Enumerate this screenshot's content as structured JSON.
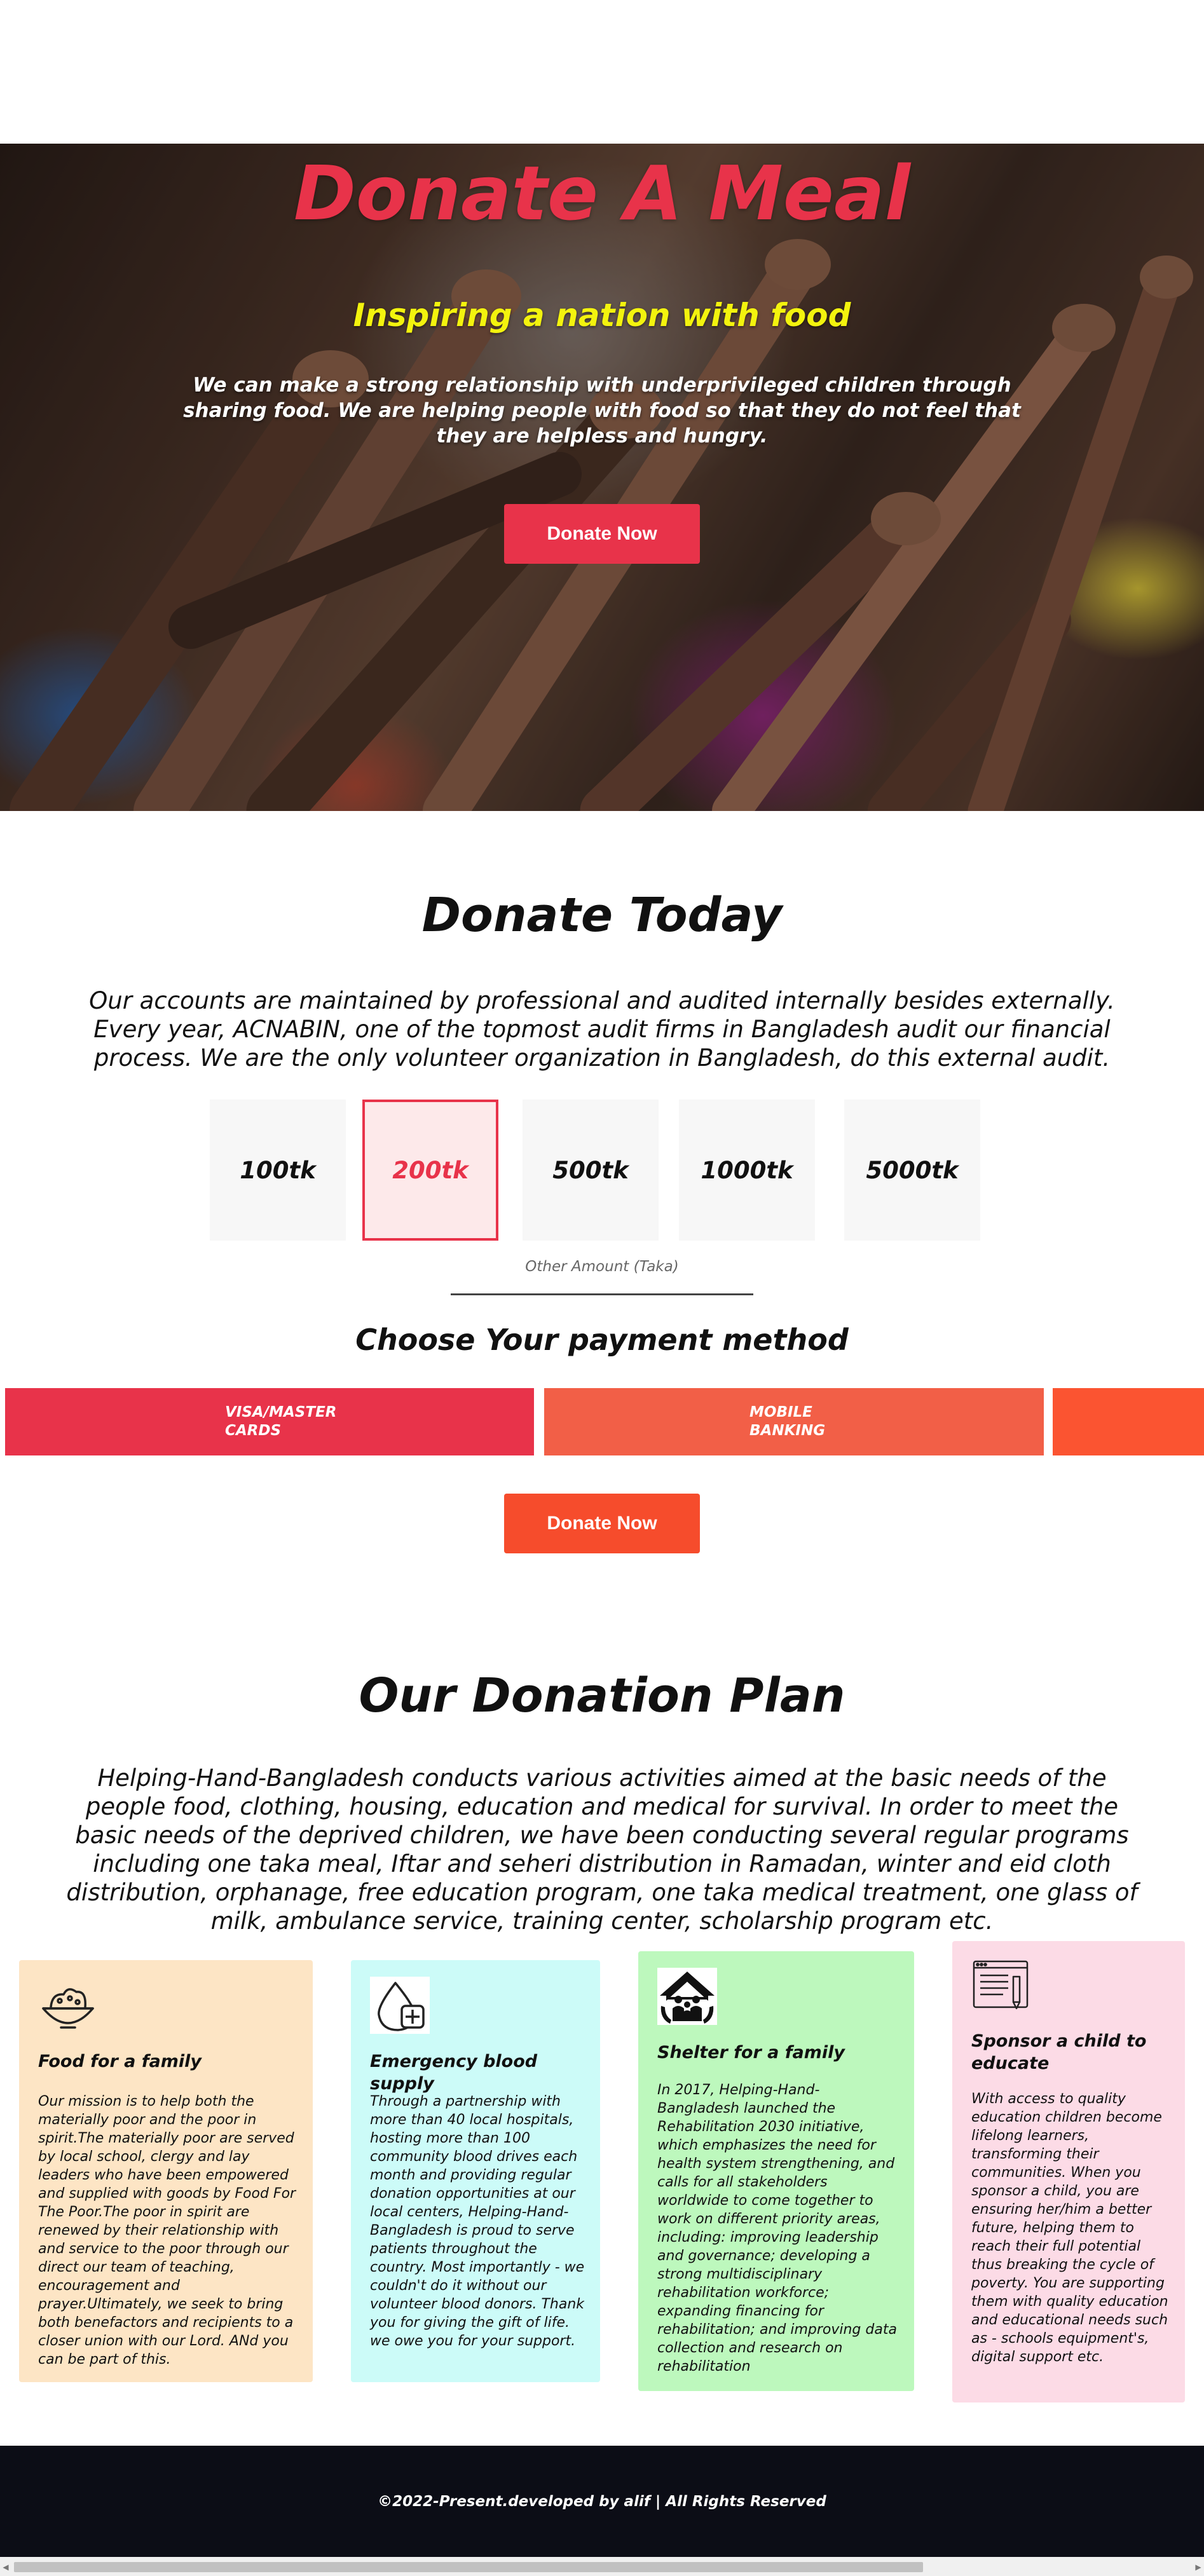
{
  "hero": {
    "title": "Donate A Meal",
    "subtitle": "Inspiring a nation with food",
    "description": "We can make a strong relationship with underprivileged children through sharing food. We are helping people with food so that they do not feel that they are helpless and hungry.",
    "button_label": "Donate Now"
  },
  "donate_today": {
    "title": "Donate Today",
    "text": "Our accounts are maintained by professional and audited internally besides externally. Every year, ACNABIN, one of the topmost audit firms in Bangladesh audit our financial process. We are the only volunteer organization in Bangladesh, do this external audit.",
    "amounts": [
      "100tk",
      "200tk",
      "500tk",
      "1000tk",
      "5000tk"
    ],
    "selected_amount": "200tk",
    "other_amount_placeholder": "Other Amount (Taka)",
    "payment_title": "Choose Your payment method",
    "payment_methods": [
      "VISA/MASTER CARDS",
      "MOBILE BANKING"
    ],
    "button_label": "Donate Now"
  },
  "plan": {
    "title": "Our Donation Plan",
    "text": "Helping-Hand-Bangladesh conducts various activities aimed at the basic needs of the people food, clothing, housing, education and medical for survival. In order to meet the basic needs of the deprived children, we have been conducting several regular programs including one taka meal, Iftar and seheri distribution in Ramadan, winter and eid cloth distribution, orphanage, free education program, one taka medical treatment, one glass of milk, ambulance service, training center, scholarship program etc.",
    "cards": [
      {
        "icon": "food-bowl-icon",
        "title": "Food for a family",
        "text": "Our mission is to help both the materially poor and the poor in spirit.The materially poor are served by local school, clergy and lay leaders who have been empowered and supplied with goods by Food For The Poor.The poor in spirit are renewed by their relationship with and service to the poor through our direct our team of teaching, encouragement and prayer.Ultimately, we seek to bring both benefactors and recipients to a closer union with our Lord. ANd you can be part of this."
      },
      {
        "icon": "blood-drop-icon",
        "title": "Emergency blood supply",
        "text": "Through a partnership with more than 40 local hospitals, hosting more than 100 community blood drives each month and providing regular donation opportunities at our local centers, Helping-Hand-Bangladesh is proud to serve patients throughout the country. Most importantly - we couldn't do it without our volunteer blood donors. Thank you for giving the gift of life. we owe you for your support."
      },
      {
        "icon": "shelter-house-icon",
        "title": "Shelter for a family",
        "text": "In 2017, Helping-Hand-Bangladesh launched the Rehabilitation 2030 initiative, which emphasizes the need for health system strengthening, and calls for all stakeholders worldwide to come together to work on different priority areas, including: improving leadership and governance; developing a strong multidisciplinary rehabilitation workforce; expanding financing for rehabilitation; and improving data collection and research on rehabilitation"
      },
      {
        "icon": "education-screen-icon",
        "title": "Sponsor a child to educate",
        "text": "With access to quality education children become lifelong learners, transforming their communities. When you sponsor a child, you are ensuring her/him a better future, helping them to reach their full potential thus breaking the cycle of poverty. You are supporting them with quality education and educational needs such as - schools equipment's, digital support etc."
      }
    ]
  },
  "footer": {
    "text": "©2022-Present.developed by alif | All Rights Reserved"
  },
  "colors": {
    "accent_red": "#e8334a",
    "accent_orange": "#f64c2c",
    "payment_red": "#e8334a",
    "payment_coral": "#f25f47",
    "payment_orange": "#fb5431",
    "card_food": "#fde5c5",
    "card_blood": "#ccfbf8",
    "card_shelter": "#bdf8bd",
    "card_education": "#fcdbe6",
    "footer_bg": "#0c0d16"
  }
}
